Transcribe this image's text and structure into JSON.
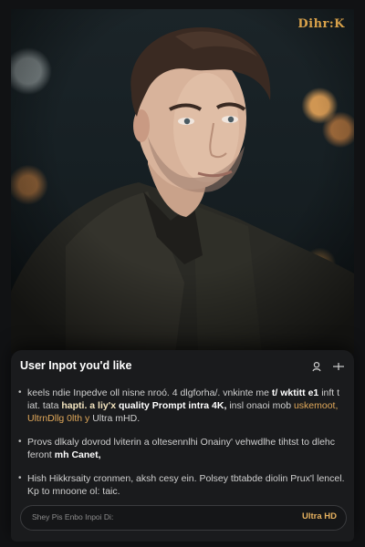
{
  "brand": {
    "logo_text": "Dihr:K"
  },
  "hero": {
    "alt_icon": "portrait-image"
  },
  "card": {
    "title": "User Inpot you'd like",
    "icons": [
      "person-icon",
      "more-icon"
    ],
    "bullets": [
      {
        "parts": [
          {
            "text": "keels ndie Inpedve oll nisne nroó. 4 dlgforha/. vnkinte me ",
            "style": "normal"
          },
          {
            "text": "t/ wktitt e1 ",
            "style": "strong"
          },
          {
            "text": "inft t iat. tata ",
            "style": "normal"
          },
          {
            "text": "hapti. a liy'x ",
            "style": "hl"
          },
          {
            "text": "quality Prompt intra 4K, ",
            "style": "strong"
          },
          {
            "text": "insl onaoi mob ",
            "style": "normal"
          },
          {
            "text": "uskemoot, UltrnDllg 0lth y ",
            "style": "gold"
          },
          {
            "text": "Ultra mHD.",
            "style": "normal"
          }
        ]
      },
      {
        "parts": [
          {
            "text": "Provs dlkaly dovrod lviterin a oltesennlhi Onainy' vehwdlhe tihtst to dlehc feront ",
            "style": "normal"
          },
          {
            "text": "mh Canet,",
            "style": "strong"
          }
        ]
      },
      {
        "parts": [
          {
            "text": "Hish Hikkrsaity cronmen, aksh cesy ein. Polsey tbtabde diolin Prux'l lencel. Kp to mnoone ol: taic.",
            "style": "normal"
          }
        ]
      }
    ],
    "input": {
      "placeholder": "Shey Pis Enbo Inpoi Di:",
      "badge": "Ultra HD"
    }
  }
}
